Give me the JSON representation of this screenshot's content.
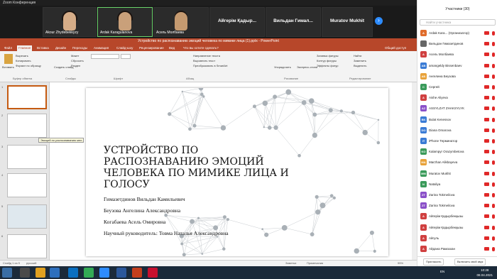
{
  "zoom": {
    "title": "Zoom Конференция"
  },
  "gallery": [
    {
      "name": "Akour Zhydebekkyzy"
    },
    {
      "name": "Ardak Karagulanova"
    },
    {
      "name": "Асель Молбаева"
    },
    {
      "name": "Айгерім Қадыр..."
    },
    {
      "name": "Вильдан  Гимал..."
    },
    {
      "name": "Muratov Mukhit"
    }
  ],
  "ppt": {
    "title": "Устройство по распознаванию эмоций человека по мимике лица (1).pptx - PowerPoint",
    "tabs": [
      "Файл",
      "Главная",
      "Вставка",
      "Дизайн",
      "Переходы",
      "Анимация",
      "Слайд-шоу",
      "Рецензирование",
      "Вид",
      "Что вы хотите сделать?"
    ],
    "share": "Общий доступ",
    "ribbon": {
      "paste": "Вставить",
      "cut": "Вырезать",
      "copy": "Копировать",
      "format": "Формат по образцу",
      "create": "Создать слайд",
      "layout": "Макет",
      "reset": "Сбросить",
      "section": "Раздел",
      "text_dir": "Направление текста",
      "align": "Выровнять текст",
      "smartart": "Преобразовать в SmartArt",
      "arrange": "Упорядочить",
      "styles": "Экспресс-стили",
      "fill": "Заливка фигуры",
      "outline": "Контур фигуры",
      "effects": "Эффекты фигур",
      "find": "Найти",
      "replace": "Заменить",
      "select": "Выделить"
    },
    "groups": [
      "Буфер обмена",
      "Слайды",
      "Шрифт",
      "Абзац",
      "Рисование",
      "Редактирование"
    ],
    "thumb_numbers": [
      "1",
      "2",
      "3",
      "4",
      "5",
      "6"
    ],
    "thumb_tooltip": "Эмоций по распознаванию мел...",
    "status": {
      "slide": "Слайд 1 из 9",
      "lang": "русский",
      "notes": "Заметки",
      "comments": "Примечания",
      "zoom": "95%"
    }
  },
  "slide": {
    "title": "УСТРОЙСТВО ПО РАСПОЗНАВАНИЮ ЭМОЦИЙ ЧЕЛОВЕКА ПО МИМИКЕ ЛИЦА И ГОЛОСУ",
    "authors": [
      "Гимазетдинов Вильдан Камильевич",
      "Беузова Ангелина Александровна",
      "Когабаева Асель Омировна",
      "Научный руководитель: Товма Наталья Александровна"
    ]
  },
  "panel": {
    "header": "Участники (30)",
    "search_placeholder": "Найти участника",
    "participants": [
      {
        "name": "Ardak Kara... (Организатор)",
        "initial": "A",
        "color": "#e06c2b"
      },
      {
        "name": "Вильдан Гимазетдинов",
        "initial": "",
        "color": "#666666"
      },
      {
        "name": "Асель Молбаева",
        "initial": "А",
        "color": "#d04040"
      },
      {
        "name": "amangeldy Bissenbaev",
        "initial": "AB",
        "color": "#3a7bd5"
      },
      {
        "name": "Ангелина Беузова",
        "initial": "АБ",
        "color": "#e8a23a"
      },
      {
        "name": "Сергей",
        "initial": "С",
        "color": "#3a9a5a"
      },
      {
        "name": "Aishe Aliyeva",
        "initial": "A",
        "color": "#d04040"
      },
      {
        "name": "ASSYLZAT ZHAKSYLYK",
        "initial": "AZ",
        "color": "#8a50c8"
      },
      {
        "name": "Bulat Kenessov",
        "initial": "BK",
        "color": "#3a7bd5"
      },
      {
        "name": "Diana Omarova",
        "initial": "DO",
        "color": "#3a7bd5"
      },
      {
        "name": "iPhone Терминатор",
        "initial": "iT",
        "color": "#3a7bd5"
      },
      {
        "name": "Kalampyr Orazymbetova",
        "initial": "KO",
        "color": "#3a9a5a"
      },
      {
        "name": "Marzhan Alikbayeva",
        "initial": "MA",
        "color": "#e8a23a"
      },
      {
        "name": "Muratov Mukhit",
        "initial": "MM",
        "color": "#3a9a5a"
      },
      {
        "name": "Nataliya",
        "initial": "N",
        "color": "#3a9a5a"
      },
      {
        "name": "Zarina Tokmeilova",
        "initial": "ZT",
        "color": "#8a50c8"
      },
      {
        "name": "Zarina Tokmeilova",
        "initial": "ZT",
        "color": "#8a50c8"
      },
      {
        "name": "Айгерім Қадырбекқызы",
        "initial": "A",
        "color": "#d04040"
      },
      {
        "name": "Айгерім Қадырбекқызы",
        "initial": "A",
        "color": "#d04040"
      },
      {
        "name": "Айгуль",
        "initial": "A",
        "color": "#d04040"
      },
      {
        "name": "Айдана Рамазхан",
        "initial": "A",
        "color": "#d04040"
      }
    ],
    "invite": "Пригласить",
    "mute": "Включить свой звук"
  },
  "taskbar": {
    "lang": "EN",
    "time": "10:28",
    "date": "08.04.2021"
  }
}
